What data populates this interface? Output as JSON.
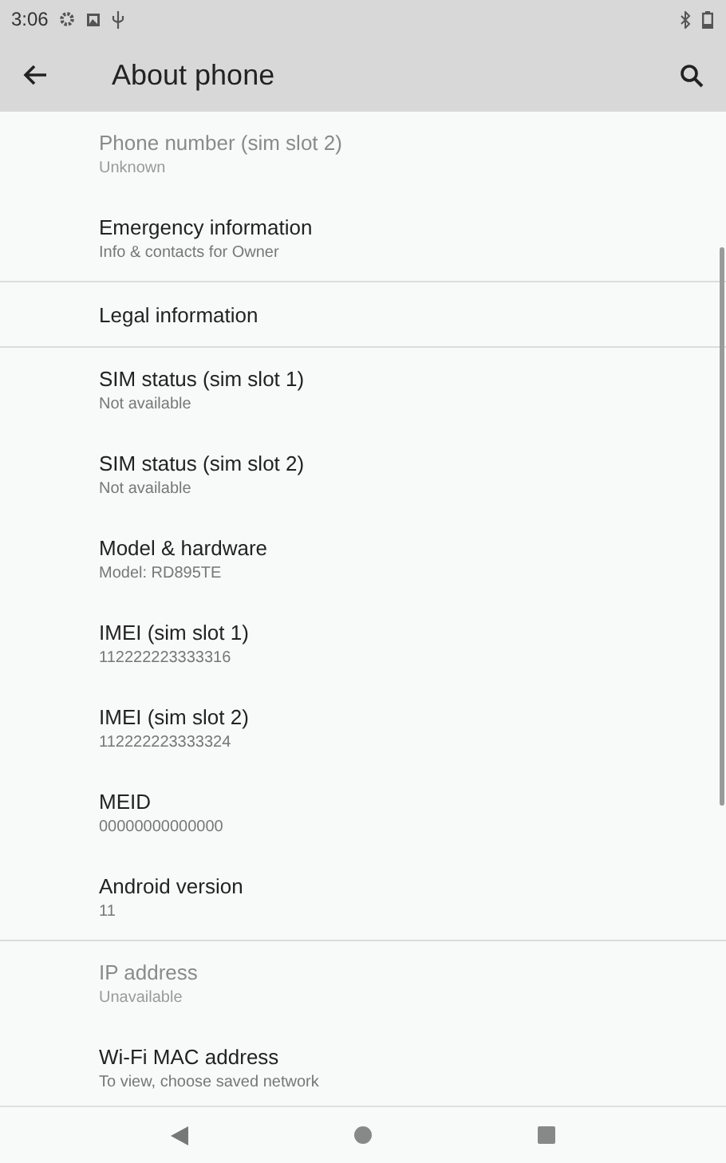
{
  "status_bar": {
    "time": "3:06"
  },
  "toolbar": {
    "title": "About phone"
  },
  "sections": [
    [
      {
        "title": "Phone number (sim slot 2)",
        "summary": "Unknown",
        "disabled": true
      },
      {
        "title": "Emergency information",
        "summary": "Info & contacts for Owner",
        "disabled": false
      }
    ],
    [
      {
        "title": "Legal information",
        "disabled": false
      }
    ],
    [
      {
        "title": "SIM status (sim slot 1)",
        "summary": "Not available",
        "disabled": false
      },
      {
        "title": "SIM status (sim slot 2)",
        "summary": "Not available",
        "disabled": false
      },
      {
        "title": "Model & hardware",
        "summary": "Model: RD895TE",
        "disabled": false
      },
      {
        "title": "IMEI (sim slot 1)",
        "summary": "112222223333316",
        "disabled": false
      },
      {
        "title": "IMEI (sim slot 2)",
        "summary": "112222223333324",
        "disabled": false
      },
      {
        "title": "MEID",
        "summary": "00000000000000",
        "disabled": false
      },
      {
        "title": "Android version",
        "summary": "11",
        "disabled": false
      }
    ],
    [
      {
        "title": "IP address",
        "summary": "Unavailable",
        "disabled": true
      },
      {
        "title": "Wi-Fi MAC address",
        "summary": "To view, choose saved network",
        "disabled": false
      }
    ]
  ]
}
